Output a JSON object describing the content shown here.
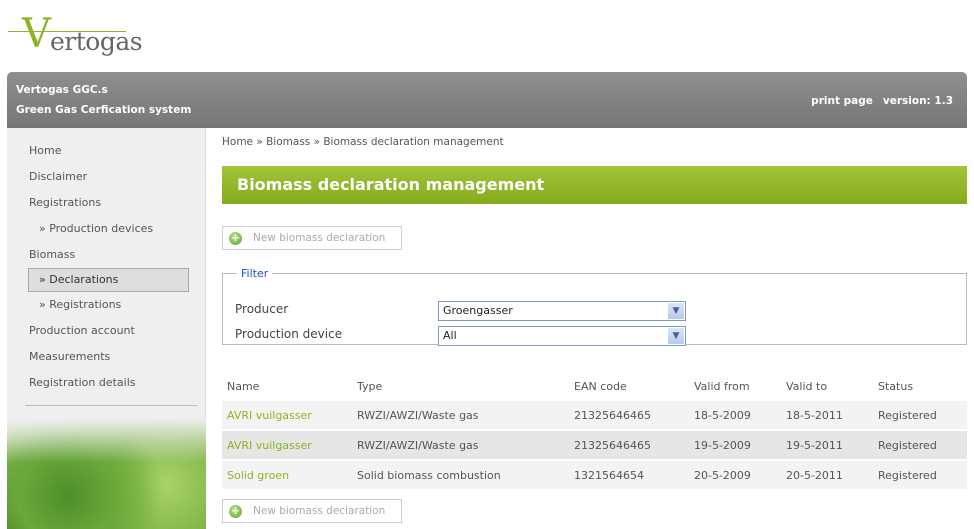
{
  "logo": {
    "text": "Vertogas"
  },
  "header": {
    "line1": "Vertogas GGC.s",
    "line2": "Green Gas Cerfication system",
    "print": "print page",
    "version": "version: 1.3"
  },
  "sidebar": {
    "items": [
      {
        "label": "Home",
        "sub": false
      },
      {
        "label": "Disclaimer",
        "sub": false
      },
      {
        "label": "Registrations",
        "sub": false
      },
      {
        "label": "» Production devices",
        "sub": true
      },
      {
        "label": "Biomass",
        "sub": false
      },
      {
        "label": "» Declarations",
        "sub": true,
        "active": true
      },
      {
        "label": "» Registrations",
        "sub": true
      },
      {
        "label": "Production account",
        "sub": false
      },
      {
        "label": "Measurements",
        "sub": false
      },
      {
        "label": "Registration details",
        "sub": false
      }
    ]
  },
  "breadcrumb": "Home » Biomass » Biomass declaration management",
  "title": "Biomass declaration management",
  "new_button": "New biomass declaration",
  "filter": {
    "legend": "Filter",
    "producer_label": "Producer",
    "producer_value": "Groengasser",
    "device_label": "Production device",
    "device_value": "All"
  },
  "table": {
    "headers": [
      "Name",
      "Type",
      "EAN code",
      "Valid from",
      "Valid to",
      "Status"
    ],
    "rows": [
      [
        "AVRI vuilgasser",
        "RWZI/AWZI/Waste gas",
        "21325646465",
        "18-5-2009",
        "18-5-2011",
        "Registered"
      ],
      [
        "AVRI vuilgasser",
        "RWZI/AWZI/Waste gas",
        "21325646465",
        "19-5-2009",
        "19-5-2011",
        "Registered"
      ],
      [
        "Solid groen",
        "Solid biomass combustion",
        "1321564654",
        "20-5-2009",
        "20-5-2011",
        "Registered"
      ]
    ]
  },
  "colors": {
    "accent": "#8cb321",
    "header": "#808080"
  }
}
